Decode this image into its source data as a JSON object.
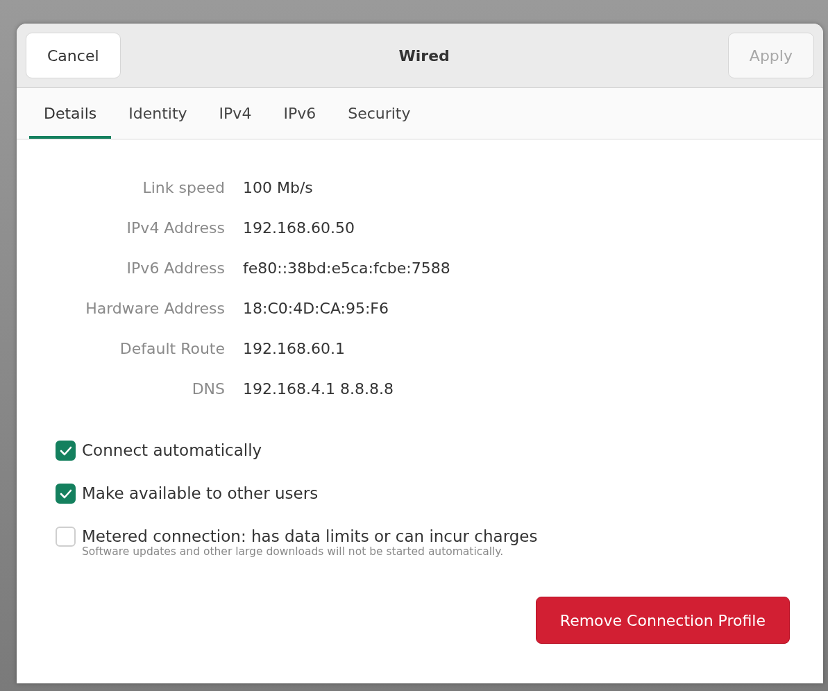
{
  "header": {
    "title": "Wired",
    "cancel": {
      "label": "Cancel",
      "disabled": false
    },
    "apply": {
      "label": "Apply",
      "disabled": true
    }
  },
  "tabs": [
    {
      "label": "Details",
      "selected": true
    },
    {
      "label": "Identity",
      "selected": false
    },
    {
      "label": "IPv4",
      "selected": false
    },
    {
      "label": "IPv6",
      "selected": false
    },
    {
      "label": "Security",
      "selected": false
    }
  ],
  "details": [
    {
      "label": "Link speed",
      "value": "100 Mb/s"
    },
    {
      "label": "IPv4 Address",
      "value": "192.168.60.50"
    },
    {
      "label": "IPv6 Address",
      "value": "fe80::38bd:e5ca:fcbe:7588"
    },
    {
      "label": "Hardware Address",
      "value": "18:C0:4D:CA:95:F6"
    },
    {
      "label": "Default Route",
      "value": "192.168.60.1"
    },
    {
      "label": "DNS",
      "value": "192.168.4.1 8.8.8.8"
    }
  ],
  "options": [
    {
      "label": "Connect automatically",
      "checked": true
    },
    {
      "label": "Make available to other users",
      "checked": true
    },
    {
      "label": "Metered connection: has data limits or can incur charges",
      "hint": "Software updates and other large downloads will not be started automatically.",
      "checked": false
    }
  ],
  "remove_button": {
    "label": "Remove Connection Profile"
  }
}
